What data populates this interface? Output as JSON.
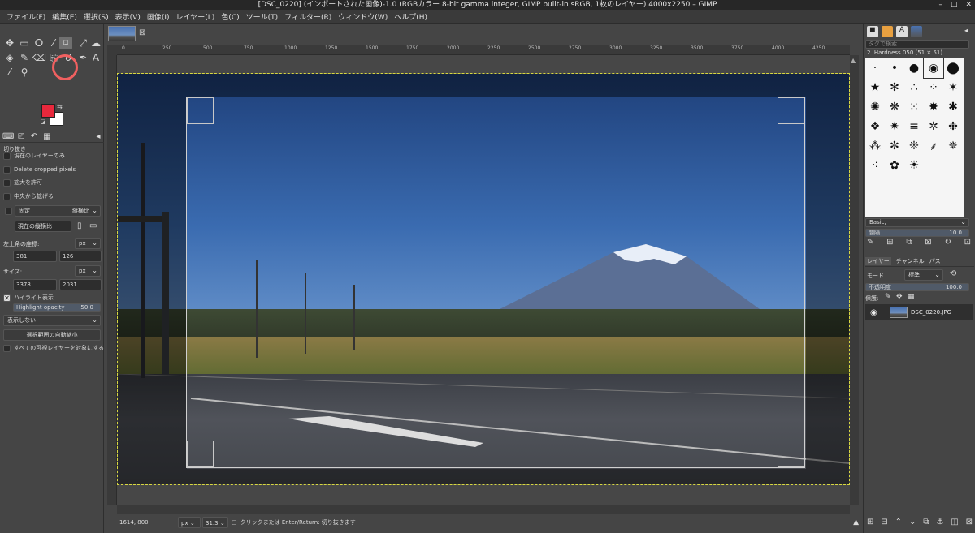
{
  "window": {
    "title": "[DSC_0220] (インポートされた画像)-1.0 (RGBカラー 8-bit gamma integer, GIMP built-in sRGB, 1枚のレイヤー) 4000x2250 – GIMP",
    "controls": [
      "–",
      "□",
      "✕"
    ]
  },
  "menu": [
    "ファイル(F)",
    "編集(E)",
    "選択(S)",
    "表示(V)",
    "画像(I)",
    "レイヤー(L)",
    "色(C)",
    "ツール(T)",
    "フィルター(R)",
    "ウィンドウ(W)",
    "ヘルプ(H)"
  ],
  "colors": {
    "foreground": "#e8283c",
    "background": "#ffffff",
    "crop_highlight": "#f06060"
  },
  "tool_options": {
    "title": "切り抜き",
    "current_layer_only": "現在のレイヤーのみ",
    "delete_cropped": "Delete cropped pixels",
    "allow_growing": "拡大を許可",
    "expand_center": "中央から拡げる",
    "fixed_label": "固定",
    "fixed_value": "縦横比",
    "fixed_ratio_field": "現在の縦横比",
    "position_label": "左上角の座標:",
    "position_unit": "px",
    "pos_x": "381",
    "pos_y": "126",
    "size_label": "サイズ:",
    "size_unit": "px",
    "size_w": "3378",
    "size_h": "2031",
    "highlight_label": "ハイライト表示",
    "highlight_opacity_label": "Highlight opacity",
    "highlight_opacity_value": "50.0",
    "guides_value": "表示しない",
    "auto_shrink": "選択範囲の自動縮小",
    "shrink_merged": "すべての可視レイヤーを対象にする"
  },
  "ruler_labels": [
    "-250",
    "0",
    "250",
    "500",
    "750",
    "1000",
    "1250",
    "1500",
    "1750",
    "2000",
    "2250",
    "2500",
    "2750",
    "3000",
    "3250",
    "3500",
    "3750",
    "4000",
    "4250"
  ],
  "status": {
    "coords": "1614, 800",
    "unit": "px",
    "zoom": "31.3",
    "message": "クリックまたは Enter/Return: 切り抜きます"
  },
  "brushes": {
    "filter_placeholder": "タグで検索",
    "current": "2. Hardness 050 (51 × 51)",
    "preset": "Basic,",
    "spacing_label": "間隔",
    "spacing_value": "10.0"
  },
  "layers": {
    "tabs": [
      "レイヤー",
      "チャンネル",
      "パス"
    ],
    "mode_label": "モード",
    "mode_value": "標準",
    "opacity_label": "不透明度",
    "opacity_value": "100.0",
    "lock_label": "保護:",
    "layer_name": "DSC_0220.JPG"
  }
}
